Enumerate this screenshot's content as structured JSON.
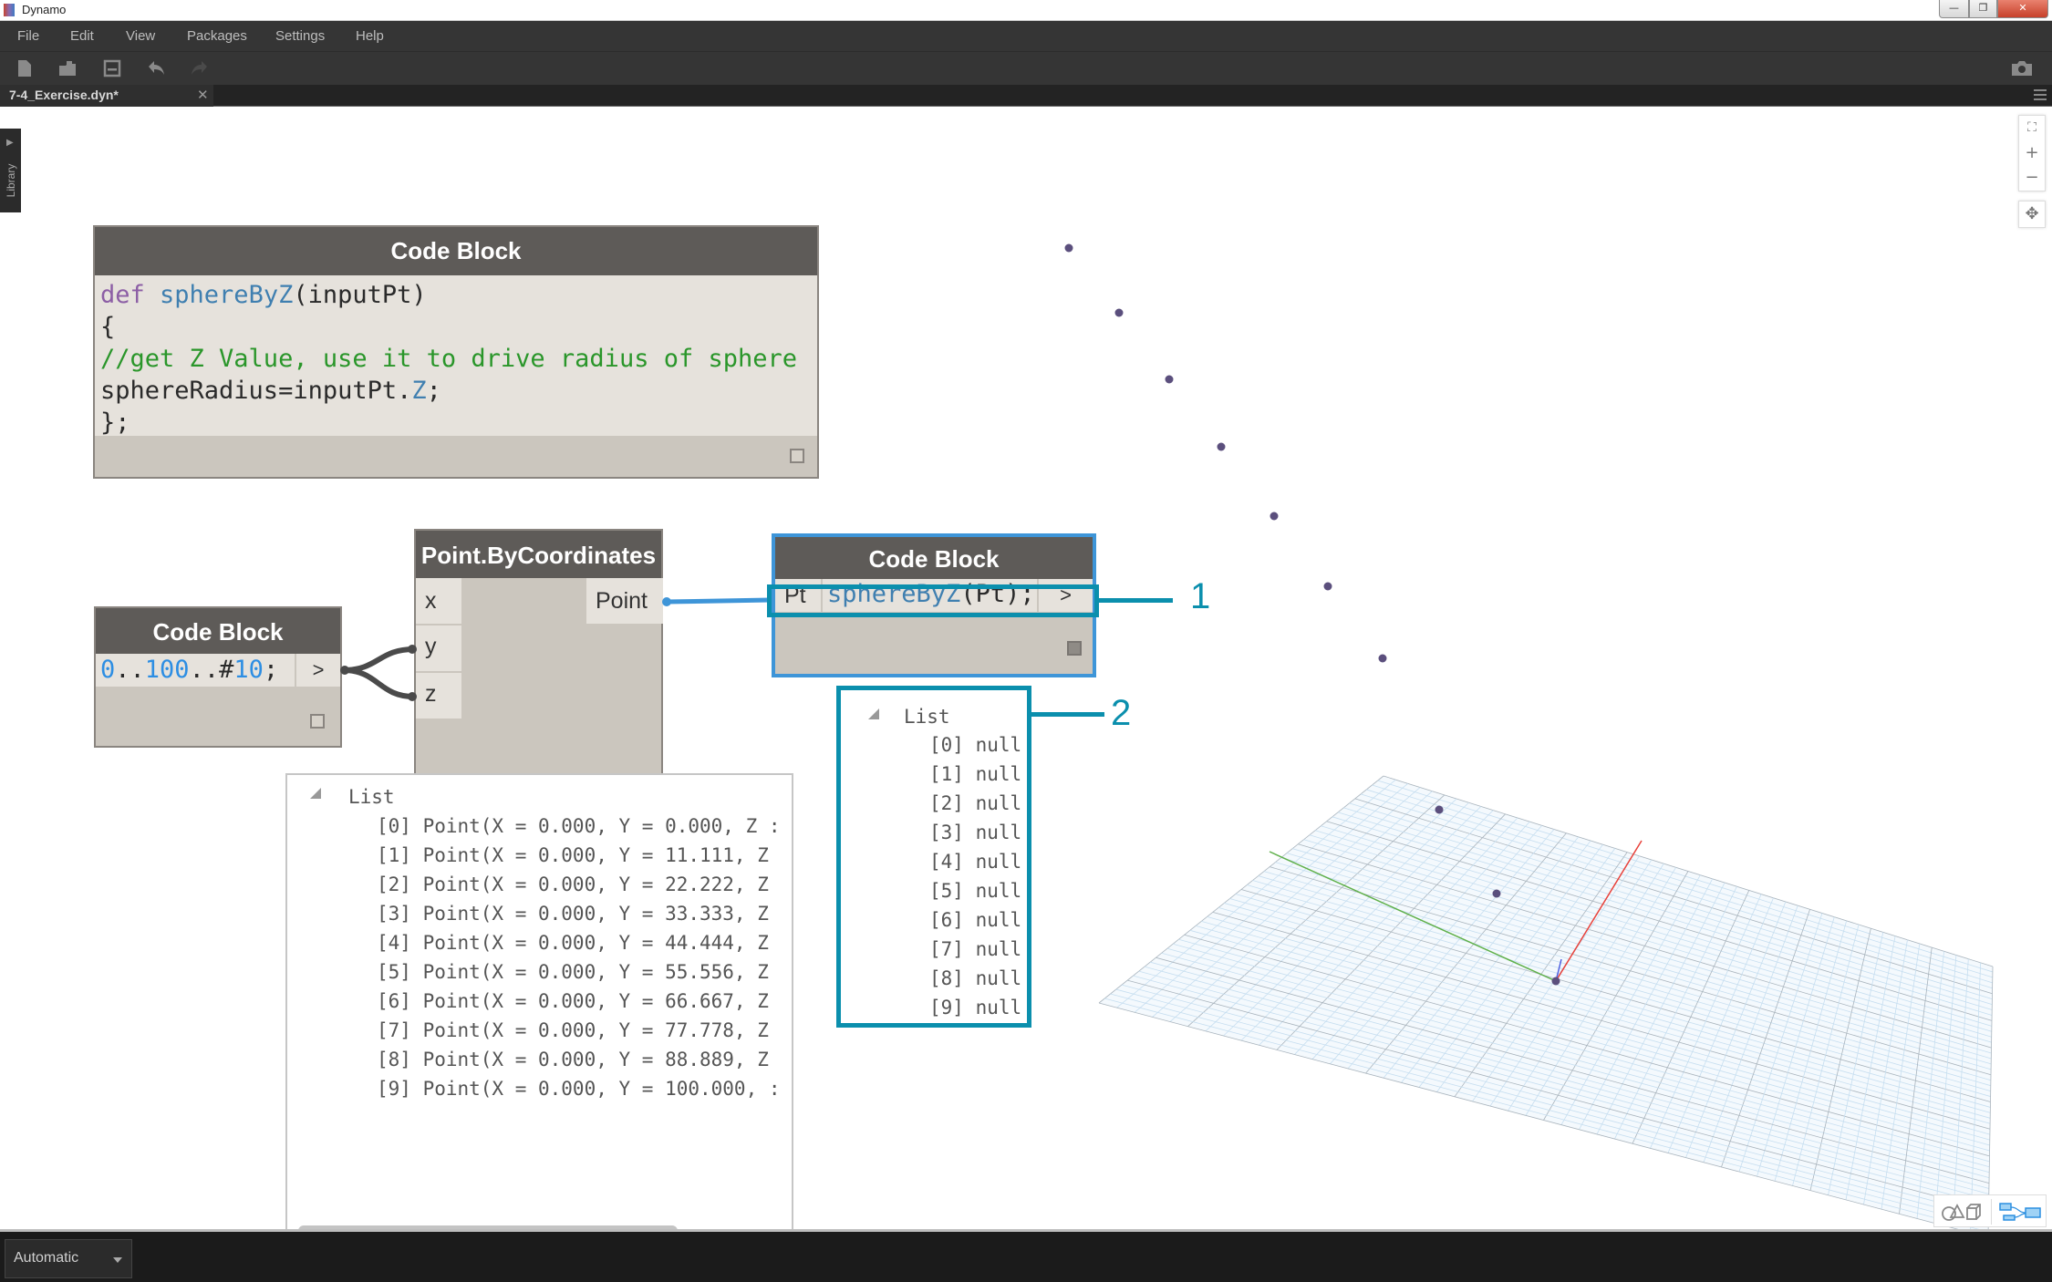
{
  "window": {
    "title": "Dynamo",
    "controls": {
      "minimize": "—",
      "maximize": "❐",
      "close": "✕"
    }
  },
  "menu": [
    "File",
    "Edit",
    "View",
    "Packages",
    "Settings",
    "Help"
  ],
  "toolbar": {
    "icons": [
      "new-file-icon",
      "open-folder-icon",
      "save-icon",
      "undo-icon",
      "redo-icon"
    ],
    "right_icon": "camera-icon"
  },
  "tab": {
    "label": "7-4_Exercise.dyn*",
    "close": "✕"
  },
  "library": {
    "label": "Library",
    "arrow": "▶"
  },
  "zoom_controls": {
    "fit": "⛶",
    "zoom_in": "+",
    "zoom_out": "−",
    "pan": "✥"
  },
  "nodes": {
    "code_def": {
      "title": "Code Block",
      "lines": [
        [
          {
            "t": "def ",
            "c": "kw"
          },
          {
            "t": "sphereByZ",
            "c": "fn"
          },
          {
            "t": "(inputPt)",
            "c": "pl"
          }
        ],
        [
          {
            "t": "{",
            "c": "pl"
          }
        ],
        [
          {
            "t": "//get Z Value, use it to drive radius of sphere",
            "c": "cm"
          }
        ],
        [
          {
            "t": "sphereRadius=inputPt.",
            "c": "pl"
          },
          {
            "t": "Z",
            "c": "fn"
          },
          {
            "t": ";",
            "c": "pl"
          }
        ],
        [
          {
            "t": "};",
            "c": "pl"
          }
        ]
      ]
    },
    "code_range": {
      "title": "Code Block",
      "code_parts": [
        {
          "t": "0",
          "c": "num"
        },
        {
          "t": "..",
          "c": "pl"
        },
        {
          "t": "100",
          "c": "num"
        },
        {
          "t": "..#",
          "c": "pl"
        },
        {
          "t": "10",
          "c": "num"
        },
        {
          "t": ";",
          "c": "pl"
        }
      ],
      "output_port": ">"
    },
    "point_by_coords": {
      "title": "Point.ByCoordinates",
      "inputs": [
        "x",
        "y",
        "z"
      ],
      "output": "Point",
      "lacing": "l"
    },
    "code_call": {
      "title": "Code Block",
      "input_port": "Pt",
      "code_parts": [
        {
          "t": "sphereByZ",
          "c": "fn"
        },
        {
          "t": "(Pt);",
          "c": "pl"
        }
      ],
      "output_port": ">"
    }
  },
  "watch_points": {
    "header": "List",
    "items": [
      "[0] Point(X = 0.000, Y = 0.000, Z :",
      "[1] Point(X = 0.000, Y = 11.111, Z",
      "[2] Point(X = 0.000, Y = 22.222, Z",
      "[3] Point(X = 0.000, Y = 33.333, Z",
      "[4] Point(X = 0.000, Y = 44.444, Z",
      "[5] Point(X = 0.000, Y = 55.556, Z",
      "[6] Point(X = 0.000, Y = 66.667, Z",
      "[7] Point(X = 0.000, Y = 77.778, Z",
      "[8] Point(X = 0.000, Y = 88.889, Z",
      "[9] Point(X = 0.000, Y = 100.000, :"
    ]
  },
  "watch_nulls": {
    "header": "List",
    "items": [
      "[0] null",
      "[1] null",
      "[2] null",
      "[3] null",
      "[4] null",
      "[5] null",
      "[6] null",
      "[7] null",
      "[8] null",
      "[9] null"
    ]
  },
  "callouts": {
    "one": "1",
    "two": "2"
  },
  "colors": {
    "accent": "#0b8fad",
    "selection": "#3e95d8",
    "point": "#5b4f7d",
    "node_header": "#5e5b58",
    "node_body": "#cbc6be"
  },
  "run": {
    "mode": "Automatic"
  }
}
